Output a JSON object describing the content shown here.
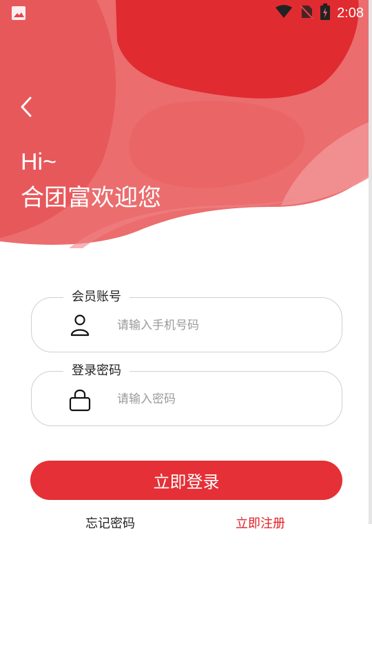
{
  "status": {
    "time": "2:08",
    "left_icon": "image-icon",
    "right_icons": [
      "wifi-icon",
      "no-sim-icon",
      "battery-charging-icon"
    ]
  },
  "header": {
    "back_icon": "chevron-left-icon",
    "greeting": "Hi~",
    "welcome": "合团富欢迎您"
  },
  "form": {
    "account": {
      "label": "会员账号",
      "placeholder": "请输入手机号码",
      "value": "",
      "icon": "user-icon"
    },
    "password": {
      "label": "登录密码",
      "placeholder": "请输入密码",
      "value": "",
      "icon": "lock-icon"
    },
    "login_label": "立即登录",
    "forgot_label": "忘记密码",
    "register_label": "立即注册"
  },
  "colors": {
    "primary": "#e43036",
    "link_red": "#e21f25",
    "hero_light": "#ec6a6c",
    "hero_dark": "#e02b31"
  }
}
